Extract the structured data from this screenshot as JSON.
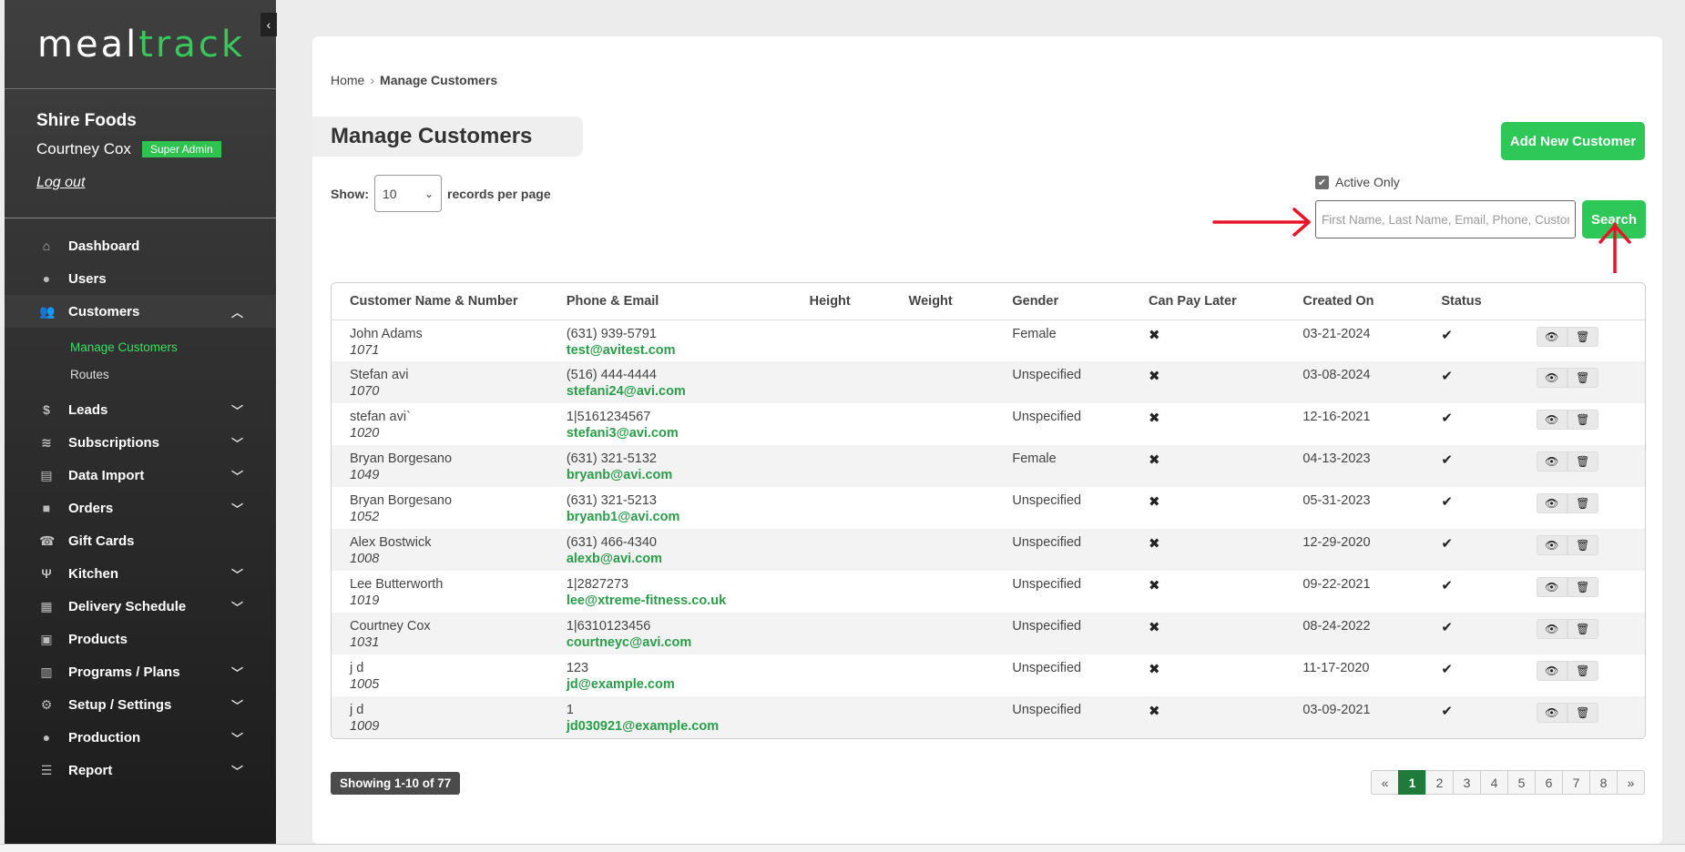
{
  "brand": {
    "part1": "meal",
    "part2": "track"
  },
  "account": {
    "company": "Shire Foods",
    "user": "Courtney Cox",
    "role": "Super Admin",
    "logout": "Log out"
  },
  "nav": [
    {
      "label": "Dashboard",
      "icon": "home-icon",
      "glyph": "⌂",
      "chevron": ""
    },
    {
      "label": "Users",
      "icon": "user-icon",
      "glyph": "●",
      "chevron": ""
    },
    {
      "label": "Customers",
      "icon": "users-icon",
      "glyph": "👥",
      "chevron": "^"
    },
    {
      "label": "Leads",
      "icon": "dollar-icon",
      "glyph": "$",
      "chevron": "⌄"
    },
    {
      "label": "Subscriptions",
      "icon": "layers-icon",
      "glyph": "≋",
      "chevron": "⌄"
    },
    {
      "label": "Data Import",
      "icon": "file-import-icon",
      "glyph": "▤",
      "chevron": "⌄"
    },
    {
      "label": "Orders",
      "icon": "shopping-bag-icon",
      "glyph": "■",
      "chevron": "⌄"
    },
    {
      "label": "Gift Cards",
      "icon": "phone-icon",
      "glyph": "☎",
      "chevron": ""
    },
    {
      "label": "Kitchen",
      "icon": "utensils-icon",
      "glyph": "Ψ",
      "chevron": "⌄"
    },
    {
      "label": "Delivery Schedule",
      "icon": "calendar-icon",
      "glyph": "▦",
      "chevron": "⌄"
    },
    {
      "label": "Products",
      "icon": "box-icon",
      "glyph": "▣",
      "chevron": ""
    },
    {
      "label": "Programs / Plans",
      "icon": "clipboard-icon",
      "glyph": "▥",
      "chevron": "⌄"
    },
    {
      "label": "Setup / Settings",
      "icon": "gear-icon",
      "glyph": "⚙",
      "chevron": "⌄"
    },
    {
      "label": "Production",
      "icon": "user-icon",
      "glyph": "●",
      "chevron": "⌄"
    },
    {
      "label": "Report",
      "icon": "list-icon",
      "glyph": "☰",
      "chevron": "⌄"
    }
  ],
  "customers_sub": [
    {
      "label": "Manage Customers"
    },
    {
      "label": "Routes"
    }
  ],
  "breadcrumb": {
    "home": "Home",
    "sep": "›",
    "current": "Manage Customers"
  },
  "page": {
    "title": "Manage Customers",
    "add_button": "Add New Customer",
    "show_label": "Show:",
    "per_page": "10",
    "records_label": "records per page",
    "active_only": "Active Only",
    "search_placeholder": "First Name, Last Name, Email, Phone, Customer #",
    "search_button": "Search"
  },
  "columns": [
    "Customer Name & Number",
    "Phone & Email",
    "Height",
    "Weight",
    "Gender",
    "Can Pay Later",
    "Created On",
    "Status",
    ""
  ],
  "rows": [
    {
      "name": "John Adams",
      "num": "1071",
      "phone": "(631) 939-5791",
      "email": "test@avitest.com",
      "height": "",
      "weight": "",
      "gender": "Female",
      "pay_later": "✖",
      "created": "03-21-2024",
      "status": "✔"
    },
    {
      "name": "Stefan avi",
      "num": "1070",
      "phone": "(516) 444-4444",
      "email": "stefani24@avi.com",
      "height": "",
      "weight": "",
      "gender": "Unspecified",
      "pay_later": "✖",
      "created": "03-08-2024",
      "status": "✔"
    },
    {
      "name": "stefan avi`",
      "num": "1020",
      "phone": "1|5161234567",
      "email": "stefani3@avi.com",
      "height": "",
      "weight": "",
      "gender": "Unspecified",
      "pay_later": "✖",
      "created": "12-16-2021",
      "status": "✔"
    },
    {
      "name": "Bryan Borgesano",
      "num": "1049",
      "phone": "(631) 321-5132",
      "email": "bryanb@avi.com",
      "height": "",
      "weight": "",
      "gender": "Female",
      "pay_later": "✖",
      "created": "04-13-2023",
      "status": "✔"
    },
    {
      "name": "Bryan Borgesano",
      "num": "1052",
      "phone": "(631) 321-5213",
      "email": "bryanb1@avi.com",
      "height": "",
      "weight": "",
      "gender": "Unspecified",
      "pay_later": "✖",
      "created": "05-31-2023",
      "status": "✔"
    },
    {
      "name": "Alex Bostwick",
      "num": "1008",
      "phone": "(631) 466-4340",
      "email": "alexb@avi.com",
      "height": "",
      "weight": "",
      "gender": "Unspecified",
      "pay_later": "✖",
      "created": "12-29-2020",
      "status": "✔"
    },
    {
      "name": "Lee Butterworth",
      "num": "1019",
      "phone": "1|2827273",
      "email": "lee@xtreme-fitness.co.uk",
      "height": "",
      "weight": "",
      "gender": "Unspecified",
      "pay_later": "✖",
      "created": "09-22-2021",
      "status": "✔"
    },
    {
      "name": "Courtney Cox",
      "num": "1031",
      "phone": "1|6310123456",
      "email": "courtneyc@avi.com",
      "height": "",
      "weight": "",
      "gender": "Unspecified",
      "pay_later": "✖",
      "created": "08-24-2022",
      "status": "✔"
    },
    {
      "name": "j d",
      "num": "1005",
      "phone": "123",
      "email": "jd@example.com",
      "height": "",
      "weight": "",
      "gender": "Unspecified",
      "pay_later": "✖",
      "created": "11-17-2020",
      "status": "✔"
    },
    {
      "name": "j d",
      "num": "1009",
      "phone": "1",
      "email": "jd030921@example.com",
      "height": "",
      "weight": "",
      "gender": "Unspecified",
      "pay_later": "✖",
      "created": "03-09-2021",
      "status": "✔"
    }
  ],
  "footer": {
    "showing": "Showing 1-10 of 77",
    "pages": [
      "«",
      "1",
      "2",
      "3",
      "4",
      "5",
      "6",
      "7",
      "8",
      "»"
    ],
    "current_page": "1"
  },
  "colors": {
    "accent": "#2ec858",
    "link": "#2a9d49",
    "sidebar": "#2a2a2a",
    "annotation": "#e8142a",
    "pager_current": "#1f7a3c"
  }
}
